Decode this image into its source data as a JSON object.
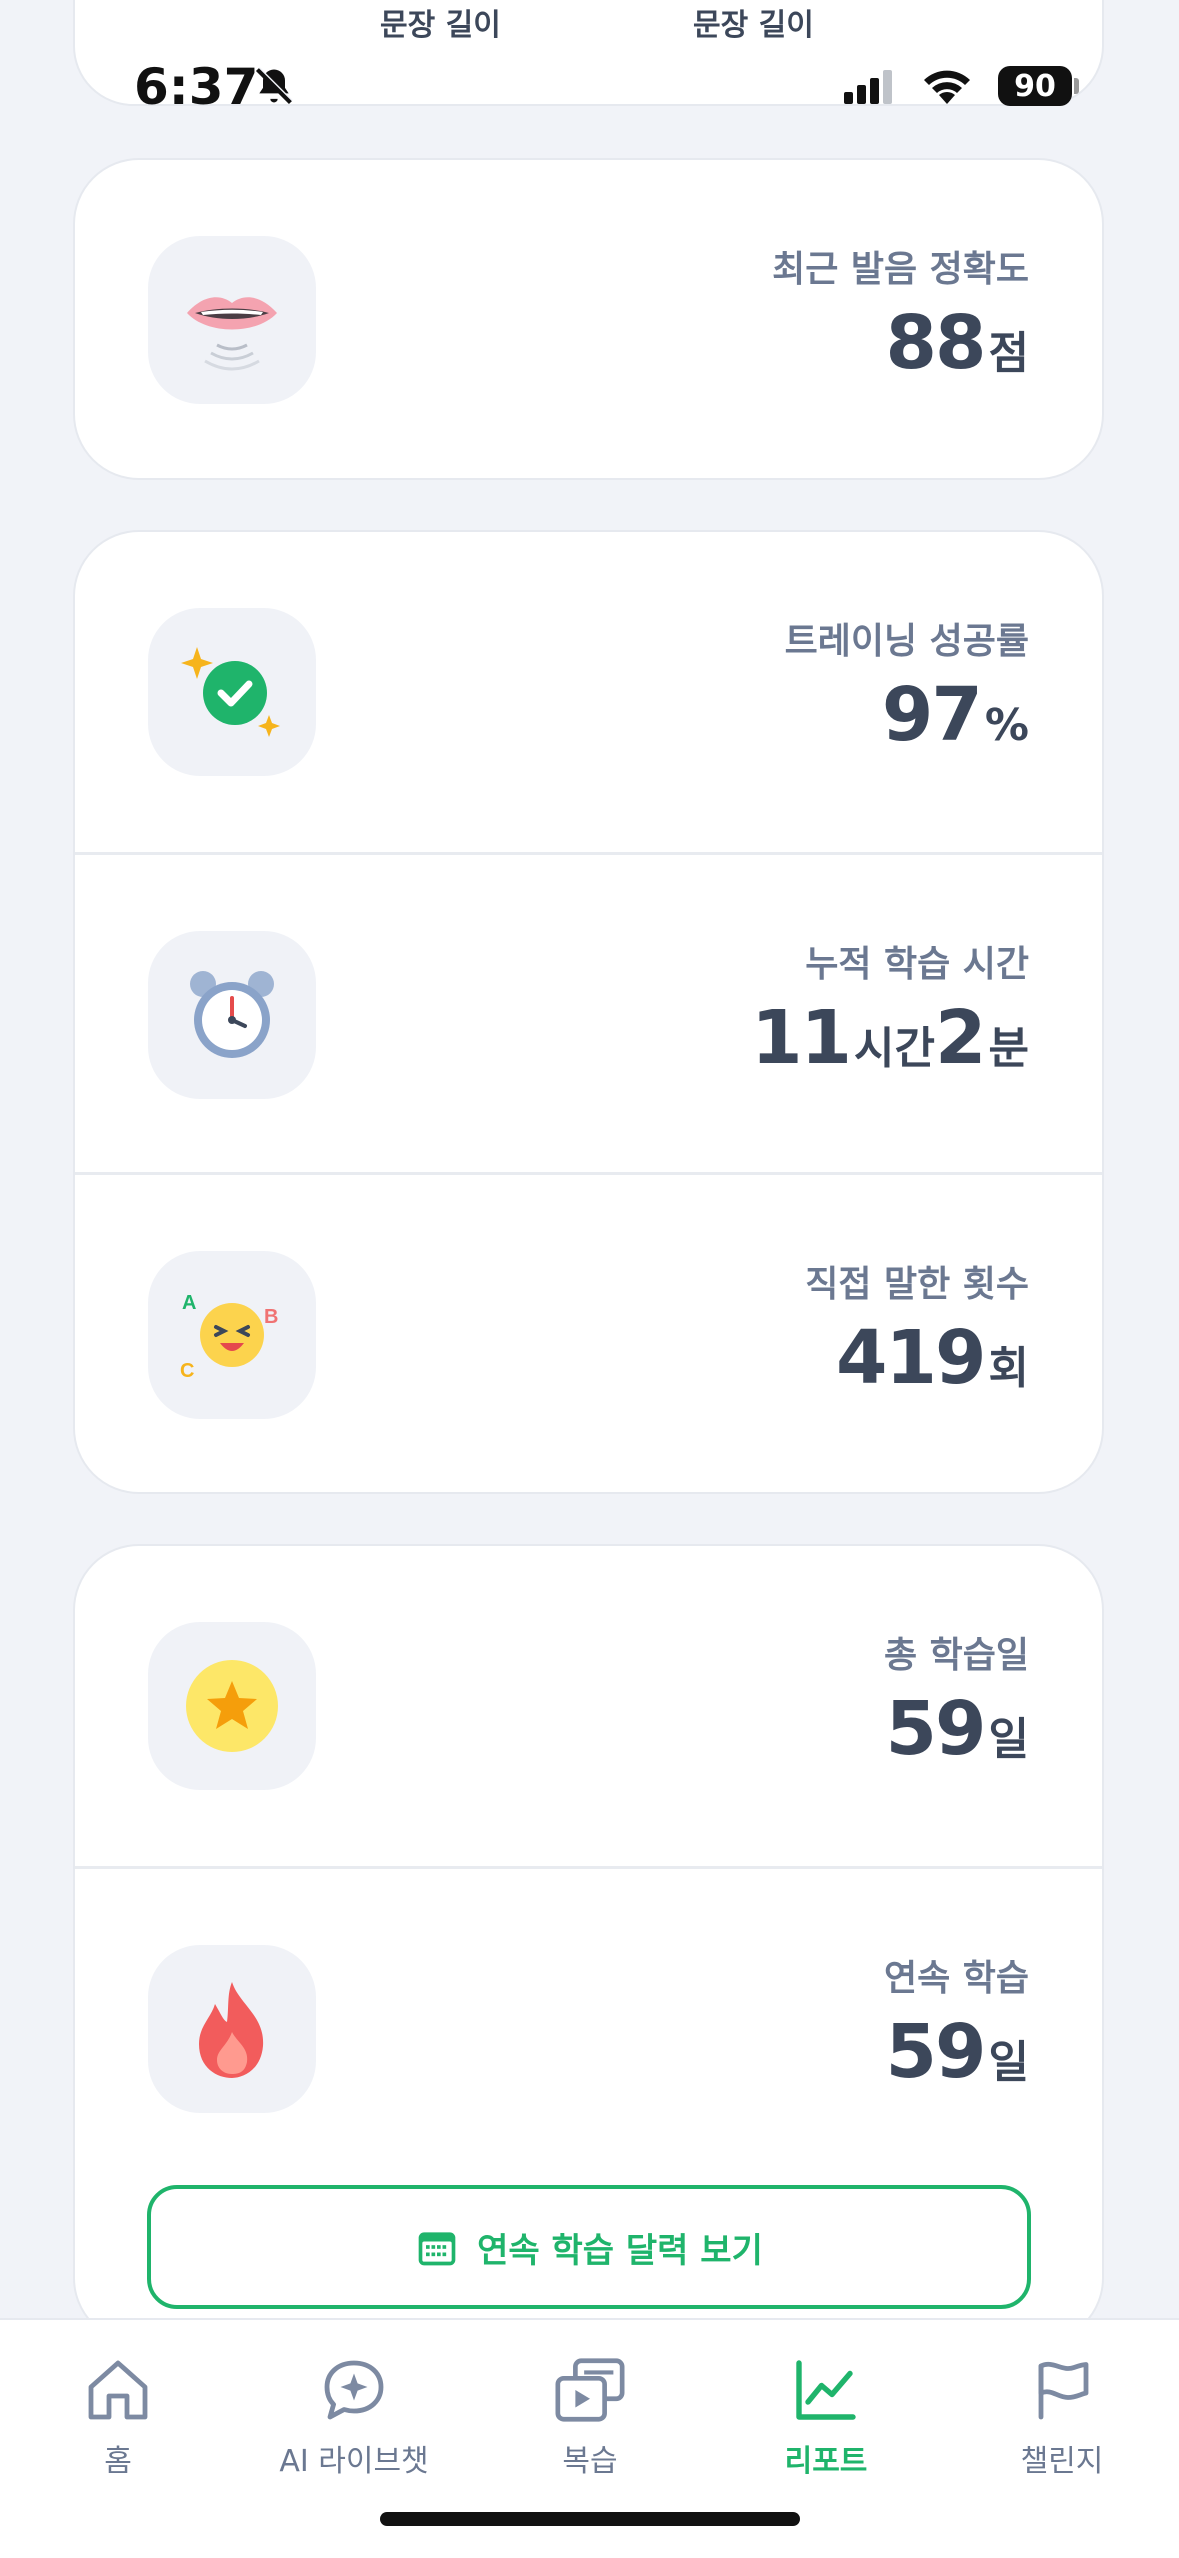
{
  "top_partial": {
    "label_left": "문장 길이",
    "label_right": "문장 길이"
  },
  "status_bar": {
    "time": "6:37",
    "battery": "90"
  },
  "stats": {
    "pronunciation": {
      "label": "최근 발음 정확도",
      "value": "88",
      "unit": "점",
      "icon": "lips-icon"
    },
    "training": {
      "label": "트레이닝 성공률",
      "value": "97",
      "unit": "%",
      "icon": "check-sparkle-icon"
    },
    "study_time": {
      "label": "누적 학습 시간",
      "hours": "11",
      "hours_unit": "시간",
      "minutes": "2",
      "minutes_unit": "분",
      "icon": "alarm-clock-icon"
    },
    "speaking": {
      "label": "직접 말한 횟수",
      "value": "419",
      "unit": "회",
      "icon": "talking-emoji-icon"
    },
    "total_days": {
      "label": "총 학습일",
      "value": "59",
      "unit": "일",
      "icon": "star-icon"
    },
    "streak": {
      "label": "연속 학습",
      "value": "59",
      "unit": "일",
      "icon": "fire-icon"
    }
  },
  "calendar_button": {
    "label": "연속 학습 달력 보기"
  },
  "tabs": [
    {
      "label": "홈",
      "icon": "home-icon"
    },
    {
      "label": "AI 라이브챗",
      "icon": "ai-chat-icon"
    },
    {
      "label": "복습",
      "icon": "review-icon"
    },
    {
      "label": "리포트",
      "icon": "report-chart-icon",
      "active": true
    },
    {
      "label": "챌린지",
      "icon": "flag-icon"
    }
  ],
  "colors": {
    "accent": "#1fb46b",
    "background": "#f1f3f8",
    "label": "#6b7891",
    "value": "#3c475a"
  }
}
